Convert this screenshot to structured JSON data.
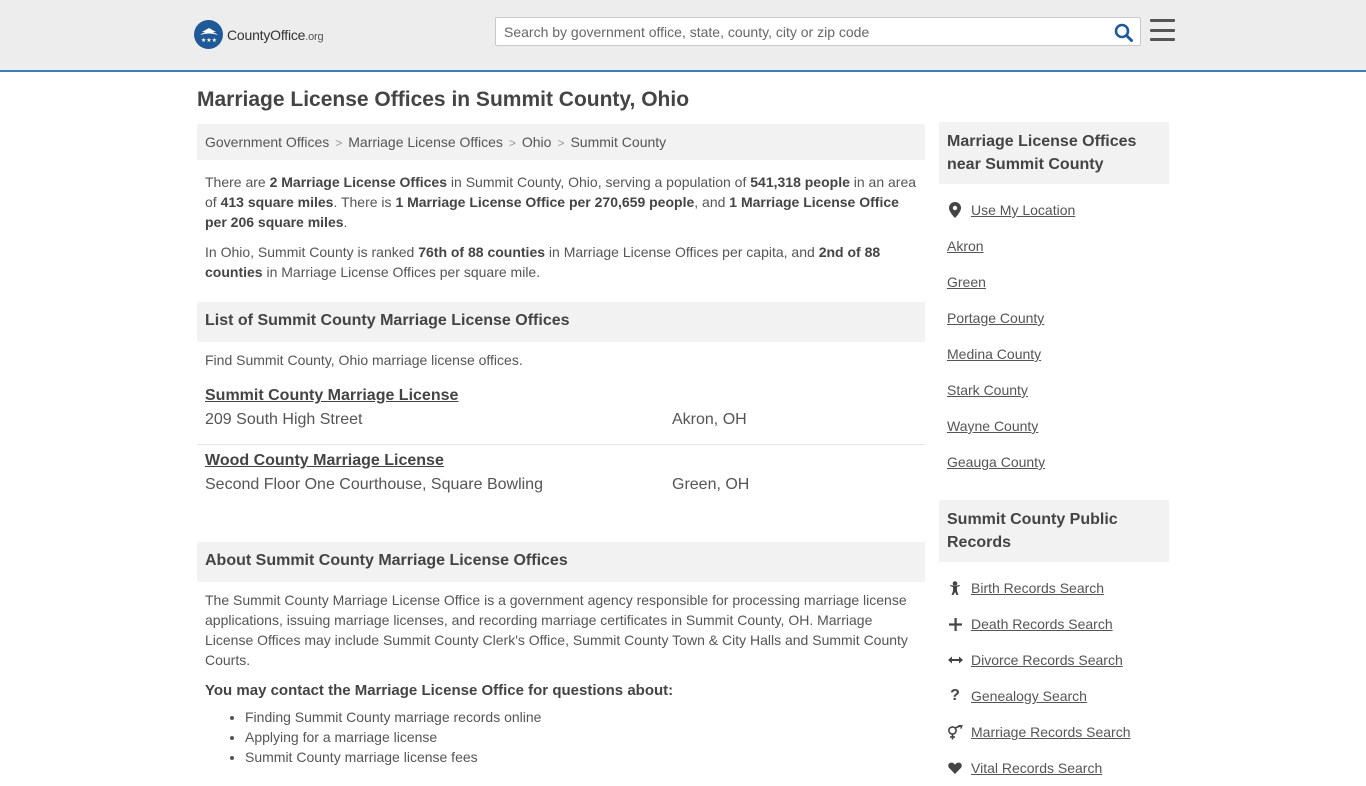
{
  "header": {
    "logo_text": "CountyOffice",
    "logo_suffix": ".org",
    "search_placeholder": "Search by government office, state, county, city or zip code"
  },
  "page_title": "Marriage License Offices in Summit County, Ohio",
  "breadcrumb": [
    "Government Offices",
    "Marriage License Offices",
    "Ohio",
    "Summit County"
  ],
  "intro": {
    "p1": [
      {
        "t": "There are ",
        "b": false
      },
      {
        "t": "2 Marriage License Offices",
        "b": true
      },
      {
        "t": " in Summit County, Ohio, serving a population of ",
        "b": false
      },
      {
        "t": "541,318 people",
        "b": true
      },
      {
        "t": " in an area of ",
        "b": false
      },
      {
        "t": "413 square miles",
        "b": true
      },
      {
        "t": ". There is ",
        "b": false
      },
      {
        "t": "1 Marriage License Office per 270,659 people",
        "b": true
      },
      {
        "t": ", and ",
        "b": false
      },
      {
        "t": "1 Marriage License Office per 206 square miles",
        "b": true
      },
      {
        "t": ".",
        "b": false
      }
    ],
    "p2": [
      {
        "t": "In Ohio, Summit County is ranked ",
        "b": false
      },
      {
        "t": "76th of 88 counties",
        "b": true
      },
      {
        "t": " in Marriage License Offices per capita, and ",
        "b": false
      },
      {
        "t": "2nd of 88 counties",
        "b": true
      },
      {
        "t": " in Marriage License Offices per square mile.",
        "b": false
      }
    ]
  },
  "list_section": {
    "heading": "List of Summit County Marriage License Offices",
    "find_text": "Find Summit County, Ohio marriage license offices.",
    "offices": [
      {
        "name": "Summit County Marriage License",
        "address": "209 South High Street",
        "city": "Akron, OH"
      },
      {
        "name": "Wood County Marriage License",
        "address": "Second Floor One Courthouse, Square Bowling",
        "city": "Green, OH"
      }
    ]
  },
  "about_section": {
    "heading": "About Summit County Marriage License Offices",
    "text": "The Summit County Marriage License Office is a government agency responsible for processing marriage license applications, issuing marriage licenses, and recording marriage certificates in Summit County, OH. Marriage License Offices may include Summit County Clerk's Office, Summit County Town & City Halls and Summit County Courts.",
    "question_heading": "You may contact the Marriage License Office for questions about:",
    "questions": [
      "Finding Summit County marriage records online",
      "Applying for a marriage license",
      "Summit County marriage license fees"
    ]
  },
  "sidebar": {
    "nearby_heading": "Marriage License Offices near Summit County",
    "use_location": "Use My Location",
    "nearby": [
      "Akron",
      "Green",
      "Portage County",
      "Medina County",
      "Stark County",
      "Wayne County",
      "Geauga County"
    ],
    "records_heading": "Summit County Public Records",
    "records": [
      {
        "label": "Birth Records Search",
        "icon": "baby-icon"
      },
      {
        "label": "Death Records Search",
        "icon": "cross-icon"
      },
      {
        "label": "Divorce Records Search",
        "icon": "arrows-icon"
      },
      {
        "label": "Genealogy Search",
        "icon": "question-icon"
      },
      {
        "label": "Marriage Records Search",
        "icon": "gender-icon"
      },
      {
        "label": "Vital Records Search",
        "icon": "heart-icon"
      }
    ]
  }
}
